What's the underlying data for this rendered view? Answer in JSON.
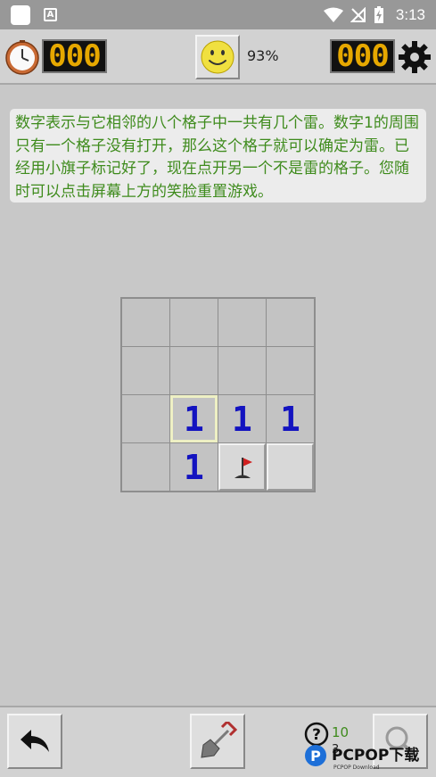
{
  "status_bar": {
    "time": "3:13",
    "notification_letter": "A"
  },
  "toolbar": {
    "timer_value": "000",
    "mine_counter_value": "000",
    "win_rate": "93%"
  },
  "hint": {
    "text": "数字表示与它相邻的八个格子中一共有几个雷。数字1的周围只有一个格子没有打开，那么这个格子就可以确定为雷。已经用小旗子标记好了，现在点开另一个不是雷的格子。您随时可以点击屏幕上方的笑脸重置游戏。"
  },
  "board": {
    "rows": [
      [
        {
          "state": "opened",
          "label": ""
        },
        {
          "state": "opened",
          "label": ""
        },
        {
          "state": "opened",
          "label": ""
        },
        {
          "state": "opened",
          "label": ""
        }
      ],
      [
        {
          "state": "opened",
          "label": ""
        },
        {
          "state": "opened",
          "label": ""
        },
        {
          "state": "opened",
          "label": ""
        },
        {
          "state": "opened",
          "label": ""
        }
      ],
      [
        {
          "state": "opened",
          "label": ""
        },
        {
          "state": "highlight",
          "label": "1"
        },
        {
          "state": "opened",
          "label": "1"
        },
        {
          "state": "opened",
          "label": "1"
        }
      ],
      [
        {
          "state": "opened",
          "label": ""
        },
        {
          "state": "opened",
          "label": "1"
        },
        {
          "state": "flag",
          "label": ""
        },
        {
          "state": "unopened",
          "label": ""
        }
      ]
    ]
  },
  "bottom": {
    "mines_count": "10",
    "mines_sub": "3",
    "watermark_text": "PCPOP下载",
    "watermark_sub": "PCPOP Download"
  },
  "colors": {
    "number_blue": "#1313c0",
    "counter_digits": "#e6a800",
    "hint_green": "#3e8b1c"
  }
}
